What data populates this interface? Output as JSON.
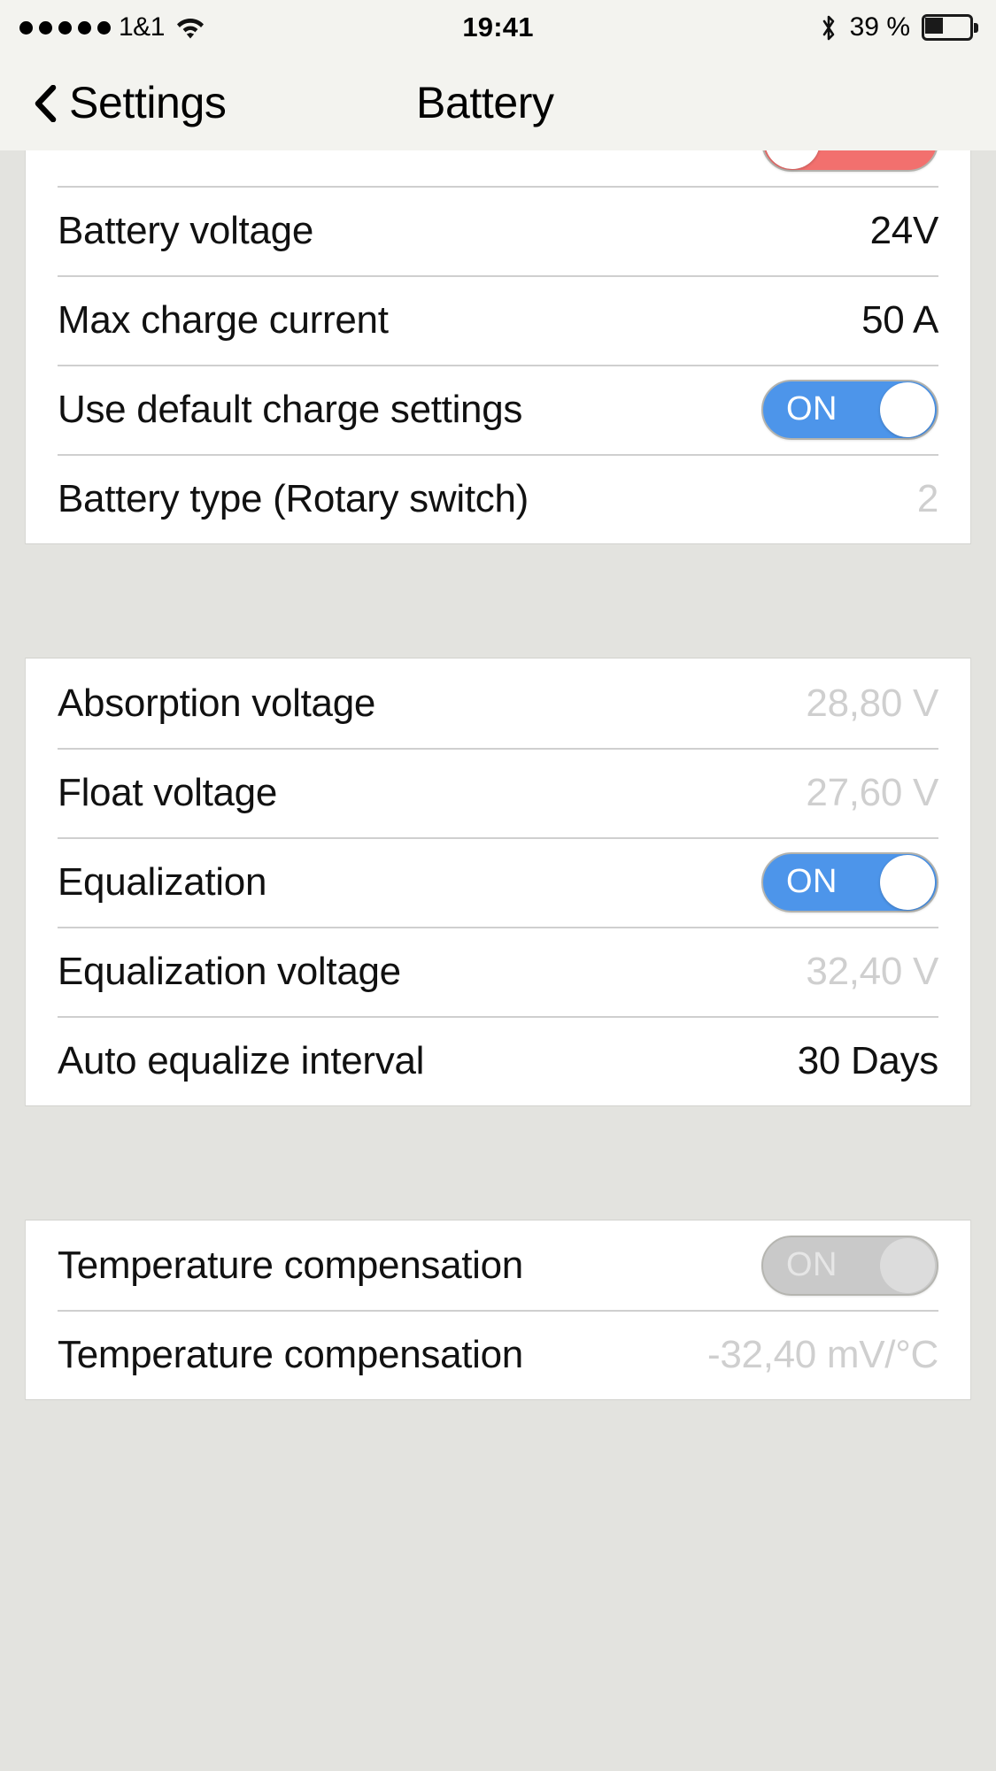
{
  "status_bar": {
    "signal_dots": 5,
    "carrier": "1&1",
    "wifi_icon": "wifi-icon",
    "time": "19:41",
    "bluetooth_icon": "bluetooth-icon",
    "battery_percent": "39 %",
    "battery_icon": "battery-icon"
  },
  "nav": {
    "back_label": "Settings",
    "back_icon": "chevron-left-icon",
    "title": "Battery"
  },
  "colors": {
    "toggle_on": "#4d95ea",
    "toggle_off": "#f2706e",
    "toggle_disabled": "#c9c9c9",
    "page_background": "#e3e3df",
    "bar_background": "#f3f3ef",
    "muted_text": "#cfcfcf"
  },
  "sections": [
    {
      "id": "charge-settings",
      "clipped_top": true,
      "rows": [
        {
          "label": "",
          "type": "toggle",
          "toggle_state": "off",
          "toggle_label": "",
          "clipped": true
        },
        {
          "label": "Battery voltage",
          "type": "value",
          "value": "24V",
          "muted": false
        },
        {
          "label": "Max charge current",
          "type": "value",
          "value": "50 A",
          "muted": false
        },
        {
          "label": "Use default charge settings",
          "type": "toggle",
          "toggle_state": "on",
          "toggle_label": "ON"
        },
        {
          "label": "Battery type (Rotary switch)",
          "type": "value",
          "value": "2",
          "muted": true
        }
      ]
    },
    {
      "id": "voltages",
      "clipped_top": false,
      "rows": [
        {
          "label": "Absorption voltage",
          "type": "value",
          "value": "28,80 V",
          "muted": true
        },
        {
          "label": "Float voltage",
          "type": "value",
          "value": "27,60 V",
          "muted": true
        },
        {
          "label": "Equalization",
          "type": "toggle",
          "toggle_state": "on",
          "toggle_label": "ON"
        },
        {
          "label": "Equalization voltage",
          "type": "value",
          "value": "32,40 V",
          "muted": true
        },
        {
          "label": "Auto equalize interval",
          "type": "value",
          "value": "30 Days",
          "muted": false
        }
      ]
    },
    {
      "id": "temperature",
      "clipped_top": false,
      "rows": [
        {
          "label": "Temperature compensation",
          "type": "toggle",
          "toggle_state": "disabled",
          "toggle_label": "ON"
        },
        {
          "label": "Temperature compensation",
          "type": "value",
          "value": "-32,40 mV/°C",
          "muted": true
        }
      ]
    }
  ]
}
